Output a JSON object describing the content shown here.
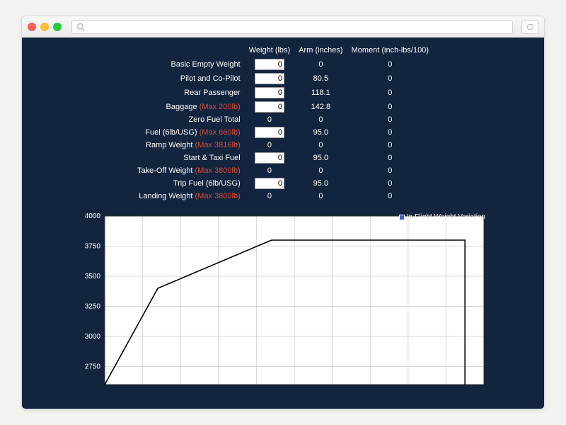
{
  "headers": {
    "weight": "Weight\n(lbs)",
    "arm": "Arm\n(inches)",
    "moment": "Moment\n(inch-lbs/100)"
  },
  "rows": [
    {
      "label": "Basic Empty Weight",
      "max": "",
      "input": true,
      "weight": "0",
      "arm": "0",
      "moment": "0"
    },
    {
      "label": "Pilot and Co-Pilot",
      "max": "",
      "input": true,
      "weight": "0",
      "arm": "80.5",
      "moment": "0"
    },
    {
      "label": "Rear Passenger",
      "max": "",
      "input": true,
      "weight": "0",
      "arm": "118.1",
      "moment": "0"
    },
    {
      "label": "Baggage",
      "max": "(Max 200lb)",
      "input": true,
      "weight": "0",
      "arm": "142.8",
      "moment": "0"
    },
    {
      "label": "Zero Fuel Total",
      "max": "",
      "input": false,
      "weight": "0",
      "arm": "0",
      "moment": "0"
    },
    {
      "label": "Fuel (6lb/USG)",
      "max": "(Max 660lb)",
      "input": true,
      "weight": "0",
      "arm": "95.0",
      "moment": "0"
    },
    {
      "label": "Ramp Weight",
      "max": "(Max 3816lb)",
      "input": false,
      "weight": "0",
      "arm": "0",
      "moment": "0"
    },
    {
      "label": "Start & Taxi Fuel",
      "max": "",
      "input": true,
      "weight": "0",
      "arm": "95.0",
      "moment": "0"
    },
    {
      "label": "Take-Off Weight",
      "max": "(Max 3800lb)",
      "input": false,
      "weight": "0",
      "arm": "0",
      "moment": "0"
    },
    {
      "label": "Trip Fuel (6lb/USG)",
      "max": "",
      "input": true,
      "weight": "0",
      "arm": "95.0",
      "moment": "0"
    },
    {
      "label": "Landing Weight",
      "max": "(Max 3800lb)",
      "input": false,
      "weight": "0",
      "arm": "0",
      "moment": "0"
    }
  ],
  "chart_data": {
    "type": "line",
    "title": "",
    "legend": "In-Flight Weight Variation",
    "ylabel": "",
    "ylim": [
      2600,
      4000
    ],
    "yticks": [
      2750,
      3000,
      3250,
      3500,
      3750,
      4000
    ],
    "xlim": [
      0,
      100
    ],
    "series": [
      {
        "name": "In-Flight Weight Variation",
        "points": [
          {
            "x": 0,
            "y": 2600
          },
          {
            "x": 14,
            "y": 3400
          },
          {
            "x": 44,
            "y": 3800
          },
          {
            "x": 95,
            "y": 3800
          },
          {
            "x": 95,
            "y": 2600
          }
        ]
      }
    ]
  }
}
